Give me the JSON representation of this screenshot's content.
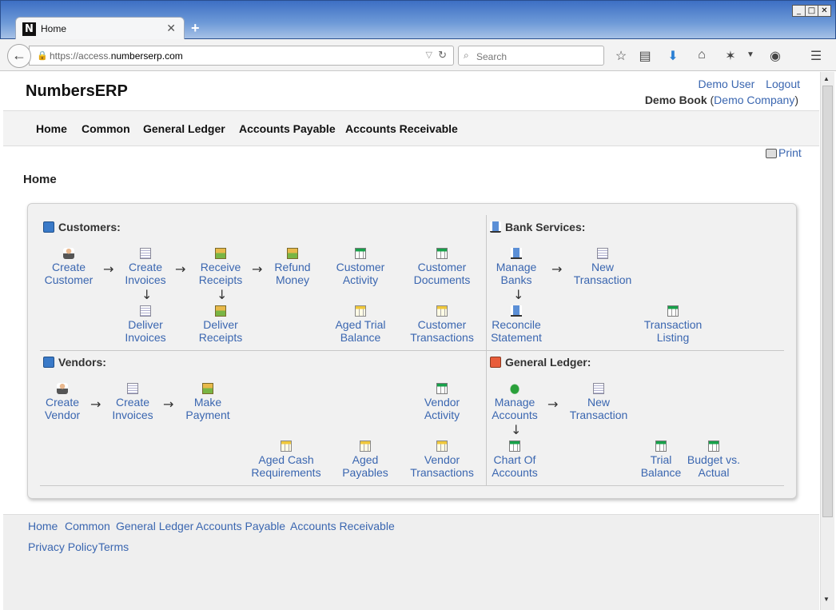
{
  "browser": {
    "tab_title": "Home",
    "tab_favicon": "N",
    "url_prefix": "https://access.",
    "url_domain": "numberserp.com",
    "search_placeholder": "Search"
  },
  "header": {
    "brand": "NumbersERP",
    "user_link": "Demo User",
    "logout_link": "Logout",
    "book_label": "Demo Book",
    "company_link": "Demo Company"
  },
  "menu": {
    "home": "Home",
    "common": "Common",
    "general_ledger": "General Ledger",
    "accounts_payable": "Accounts Payable",
    "accounts_receivable": "Accounts Receivable"
  },
  "print_label": "Print",
  "page_title": "Home",
  "sections": {
    "customers": {
      "title": "Customers:",
      "create_customer": [
        "Create",
        "Customer"
      ],
      "create_invoices": [
        "Create",
        "Invoices"
      ],
      "receive_receipts": [
        "Receive",
        "Receipts"
      ],
      "refund_money": [
        "Refund",
        "Money"
      ],
      "customer_activity": [
        "Customer",
        "Activity"
      ],
      "customer_documents": [
        "Customer",
        "Documents"
      ],
      "deliver_invoices": [
        "Deliver",
        "Invoices"
      ],
      "deliver_receipts": [
        "Deliver",
        "Receipts"
      ],
      "aged_trial_balance": [
        "Aged Trial",
        "Balance"
      ],
      "customer_transactions": [
        "Customer",
        "Transactions"
      ]
    },
    "bank": {
      "title": "Bank Services:",
      "manage_banks": [
        "Manage",
        "Banks"
      ],
      "new_transaction": [
        "New",
        "Transaction"
      ],
      "reconcile_statement": [
        "Reconcile",
        "Statement"
      ],
      "transaction_listing": [
        "Transaction",
        "Listing"
      ]
    },
    "vendors": {
      "title": "Vendors:",
      "create_vendor": [
        "Create",
        "Vendor"
      ],
      "create_invoices": [
        "Create",
        "Invoices"
      ],
      "make_payment": [
        "Make",
        "Payment"
      ],
      "vendor_activity": [
        "Vendor",
        "Activity"
      ],
      "aged_cash_requirements": [
        "Aged Cash",
        "Requirements"
      ],
      "aged_payables": [
        "Aged",
        "Payables"
      ],
      "vendor_transactions": [
        "Vendor",
        "Transactions"
      ]
    },
    "gl": {
      "title": "General Ledger:",
      "manage_accounts": [
        "Manage",
        "Accounts"
      ],
      "new_transaction": [
        "New",
        "Transaction"
      ],
      "chart_of_accounts": [
        "Chart Of",
        "Accounts"
      ],
      "trial_balance": [
        "Trial",
        "Balance"
      ],
      "budget_vs_actual": [
        "Budget vs.",
        "Actual"
      ]
    }
  },
  "arrows": {
    "right": "→",
    "down": "↓"
  },
  "footer": {
    "home": "Home",
    "common": "Common",
    "general_ledger": "General Ledger",
    "accounts_payable": "Accounts Payable",
    "accounts_receivable": "Accounts Receivable",
    "privacy": "Privacy Policy",
    "terms": "Terms"
  }
}
